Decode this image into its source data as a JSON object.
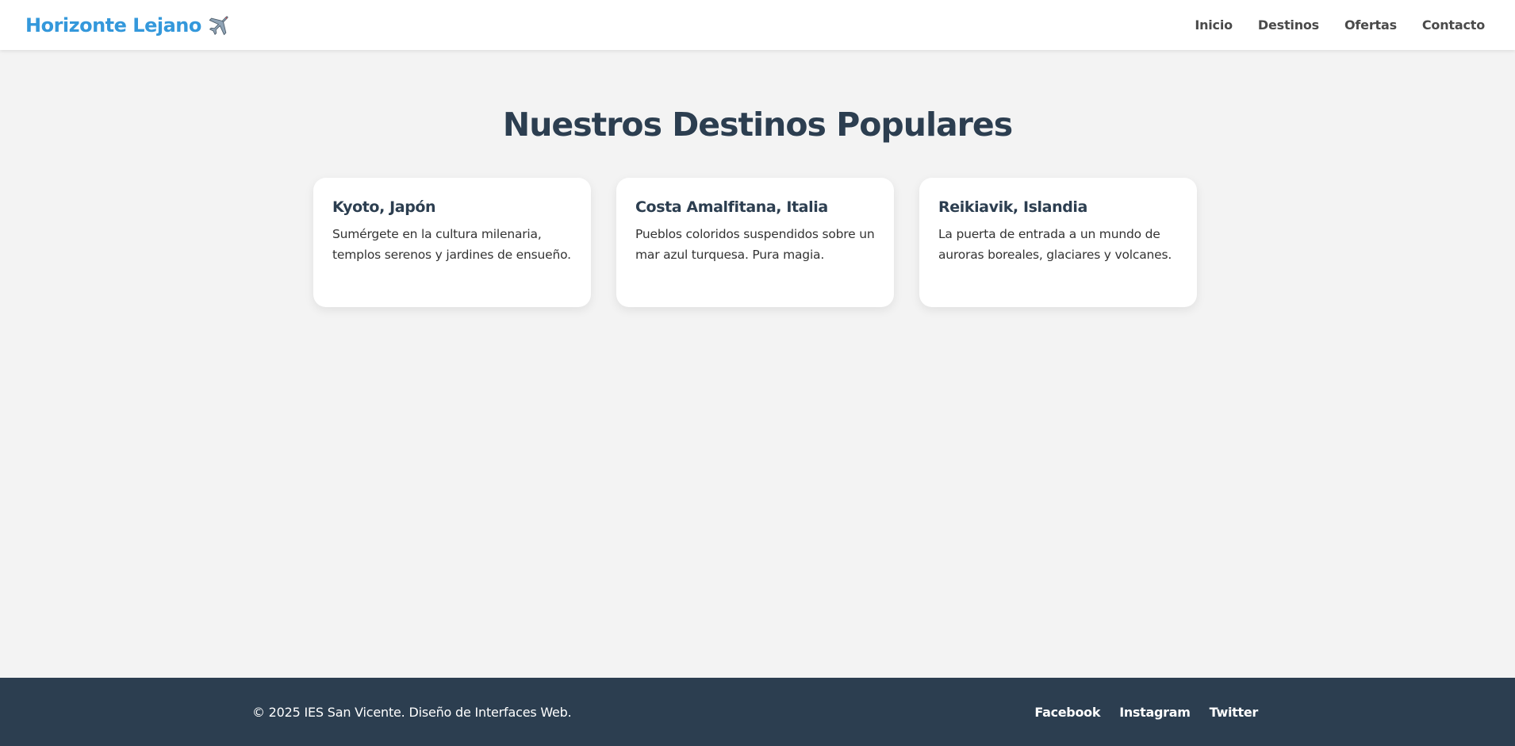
{
  "header": {
    "logo_text": "Horizonte Lejano",
    "logo_icon": "airplane-icon",
    "nav": [
      {
        "label": "Inicio"
      },
      {
        "label": "Destinos"
      },
      {
        "label": "Ofertas"
      },
      {
        "label": "Contacto"
      }
    ]
  },
  "main": {
    "title": "Nuestros Destinos Populares",
    "cards": [
      {
        "title": "Kyoto, Japón",
        "text": "Sumérgete en la cultura milenaria, templos serenos y jardines de ensueño."
      },
      {
        "title": "Costa Amalfitana, Italia",
        "text": "Pueblos coloridos suspendidos sobre un mar azul turquesa. Pura magia."
      },
      {
        "title": "Reikiavik, Islandia",
        "text": "La puerta de entrada a un mundo de auroras boreales, glaciares y volcanes."
      }
    ]
  },
  "footer": {
    "copyright": "© 2025 IES San Vicente. Diseño de Interfaces Web.",
    "social": [
      {
        "label": "Facebook"
      },
      {
        "label": "Instagram"
      },
      {
        "label": "Twitter"
      }
    ]
  },
  "colors": {
    "brand": "#3498db",
    "dark": "#2c3e50",
    "background": "#f3f3f3",
    "card": "#ffffff"
  }
}
